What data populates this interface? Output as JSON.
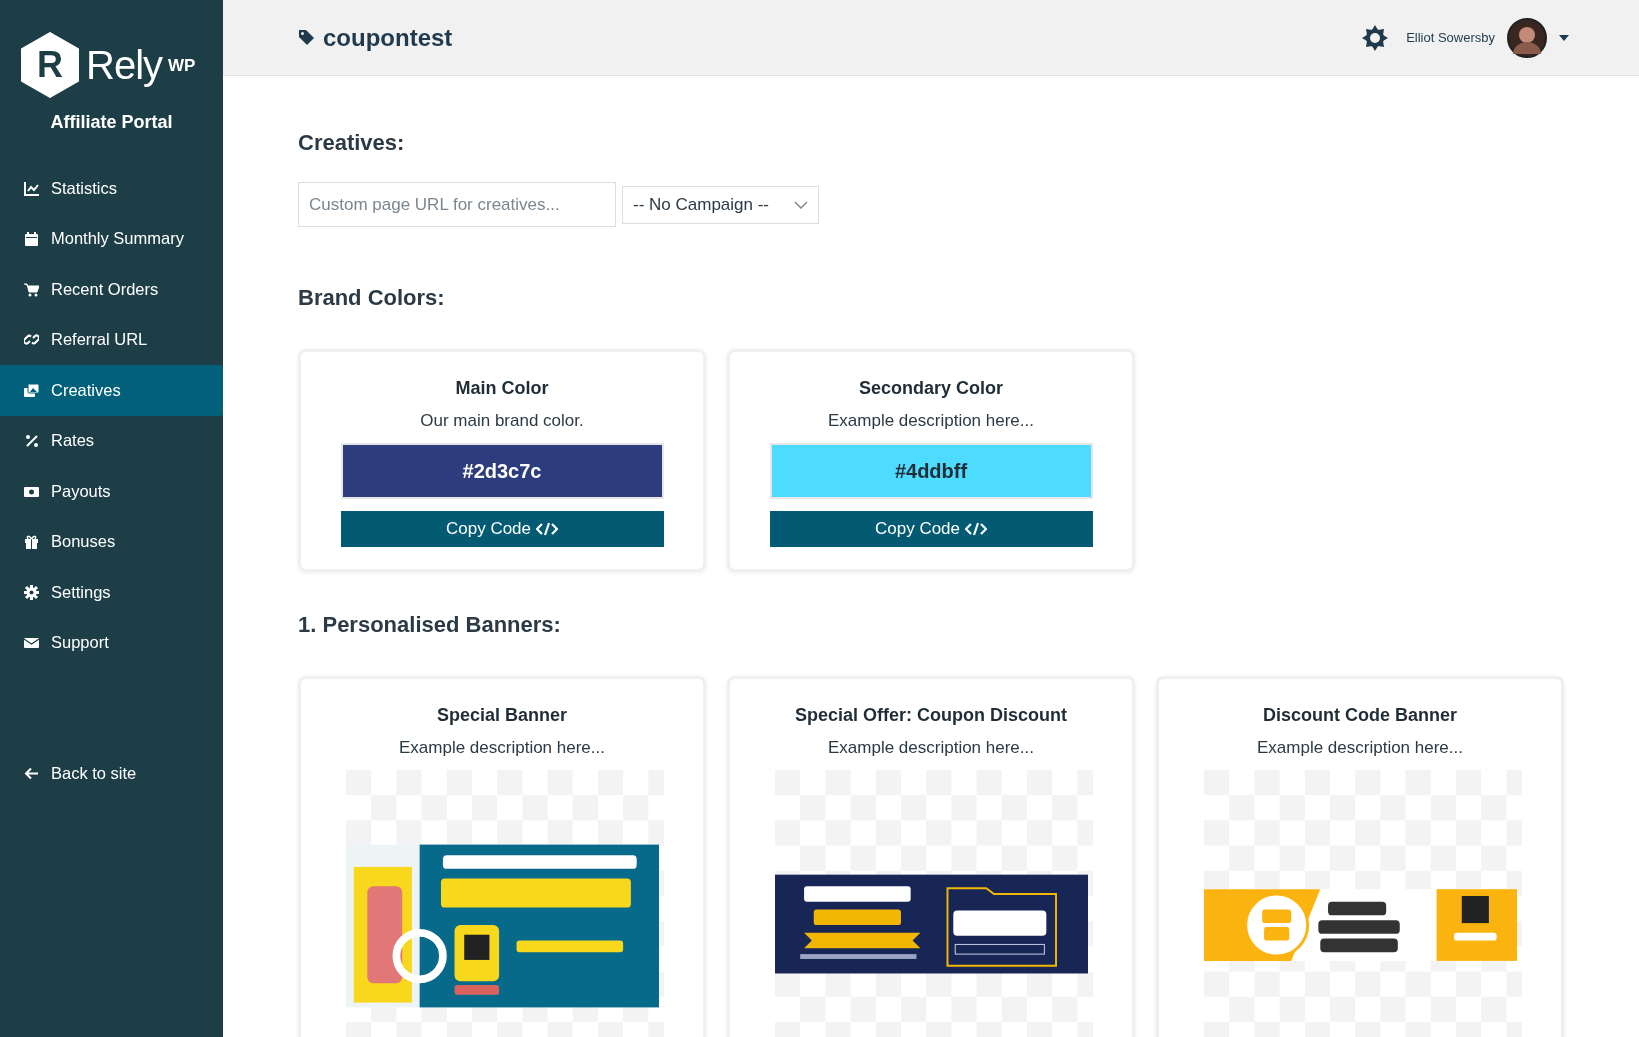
{
  "sidebar": {
    "logo": {
      "mark": "R",
      "name": "Rely",
      "suffix": "WP"
    },
    "subtitle": "Affiliate Portal",
    "items": [
      {
        "label": "Statistics",
        "selected": false
      },
      {
        "label": "Monthly Summary",
        "selected": false
      },
      {
        "label": "Recent Orders",
        "selected": false
      },
      {
        "label": "Referral URL",
        "selected": false
      },
      {
        "label": "Creatives",
        "selected": true
      },
      {
        "label": "Rates",
        "selected": false
      },
      {
        "label": "Payouts",
        "selected": false
      },
      {
        "label": "Bonuses",
        "selected": false
      },
      {
        "label": "Settings",
        "selected": false
      },
      {
        "label": "Support",
        "selected": false
      }
    ],
    "back_link": "Back to site"
  },
  "header": {
    "title": "coupontest",
    "user_name": "Elliot Sowersby"
  },
  "creatives": {
    "heading": "Creatives:",
    "url_field": {
      "placeholder": "Custom page URL for creatives..."
    },
    "campaign_select": {
      "value": "-- No Campaign --"
    }
  },
  "brand_colors": {
    "heading": "Brand Colors:",
    "cards": [
      {
        "title": "Main Color",
        "description": "Our main brand color.",
        "color": "#2d3c7c",
        "code": "#2d3c7c",
        "button": "Copy Code"
      },
      {
        "title": "Secondary Color",
        "description": "Example description here...",
        "color": "#4ddbff",
        "code": "#4ddbff",
        "button": "Copy Code"
      }
    ]
  },
  "banners": {
    "heading": "1. Personalised Banners:",
    "cards": [
      {
        "title": "Special Banner",
        "description": "Example description here..."
      },
      {
        "title": "Special Offer: Coupon Discount",
        "description": "Example description here..."
      },
      {
        "title": "Discount Code Banner",
        "description": "Example description here..."
      }
    ]
  }
}
